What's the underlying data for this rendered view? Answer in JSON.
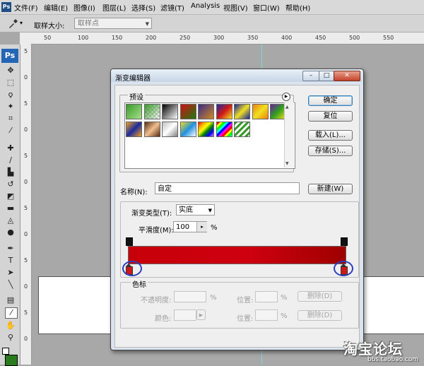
{
  "app": {
    "icon_label": "Ps"
  },
  "menubar": {
    "items": [
      "文件(F)",
      "编辑(E)",
      "图像(I)",
      "图层(L)",
      "选择(S)",
      "滤镜(T)",
      "Analysis",
      "视图(V)",
      "窗口(W)",
      "帮助(H)"
    ]
  },
  "options_bar": {
    "sample_size_label": "取样大小:",
    "sample_size_value": "取样点"
  },
  "ruler": {
    "top_ticks": [
      "50",
      "100",
      "150",
      "200",
      "250",
      "300",
      "350",
      "400",
      "450",
      "500",
      "550"
    ],
    "left_ticks": [
      "5",
      "0",
      "5",
      "0",
      "5",
      "0",
      "5",
      "0",
      "5",
      "0",
      "5",
      "0"
    ]
  },
  "dialog": {
    "title": "渐变编辑器",
    "presets_label": "预设",
    "buttons": {
      "ok": "确定",
      "reset": "复位",
      "load": "载入(L)...",
      "save": "存储(S)...",
      "new": "新建(W)"
    },
    "name_label": "名称(N):",
    "name_value": "自定",
    "gradient_type_label": "渐变类型(T):",
    "gradient_type_value": "实底",
    "smoothness_label": "平滑度(M):",
    "smoothness_value": "100",
    "percent_sign": "%",
    "stops_label": "色标",
    "opacity_label": "不透明度:",
    "location_label": "位置:",
    "color_label": "颜色:",
    "delete_label": "删除(D)"
  },
  "colors": {
    "gradient_start": "#c60008",
    "gradient_end": "#9e0000",
    "stop_ring": "#2c3fbf"
  },
  "watermark": {
    "main": "淘宝论坛",
    "url": "bbs.taobao.com"
  }
}
